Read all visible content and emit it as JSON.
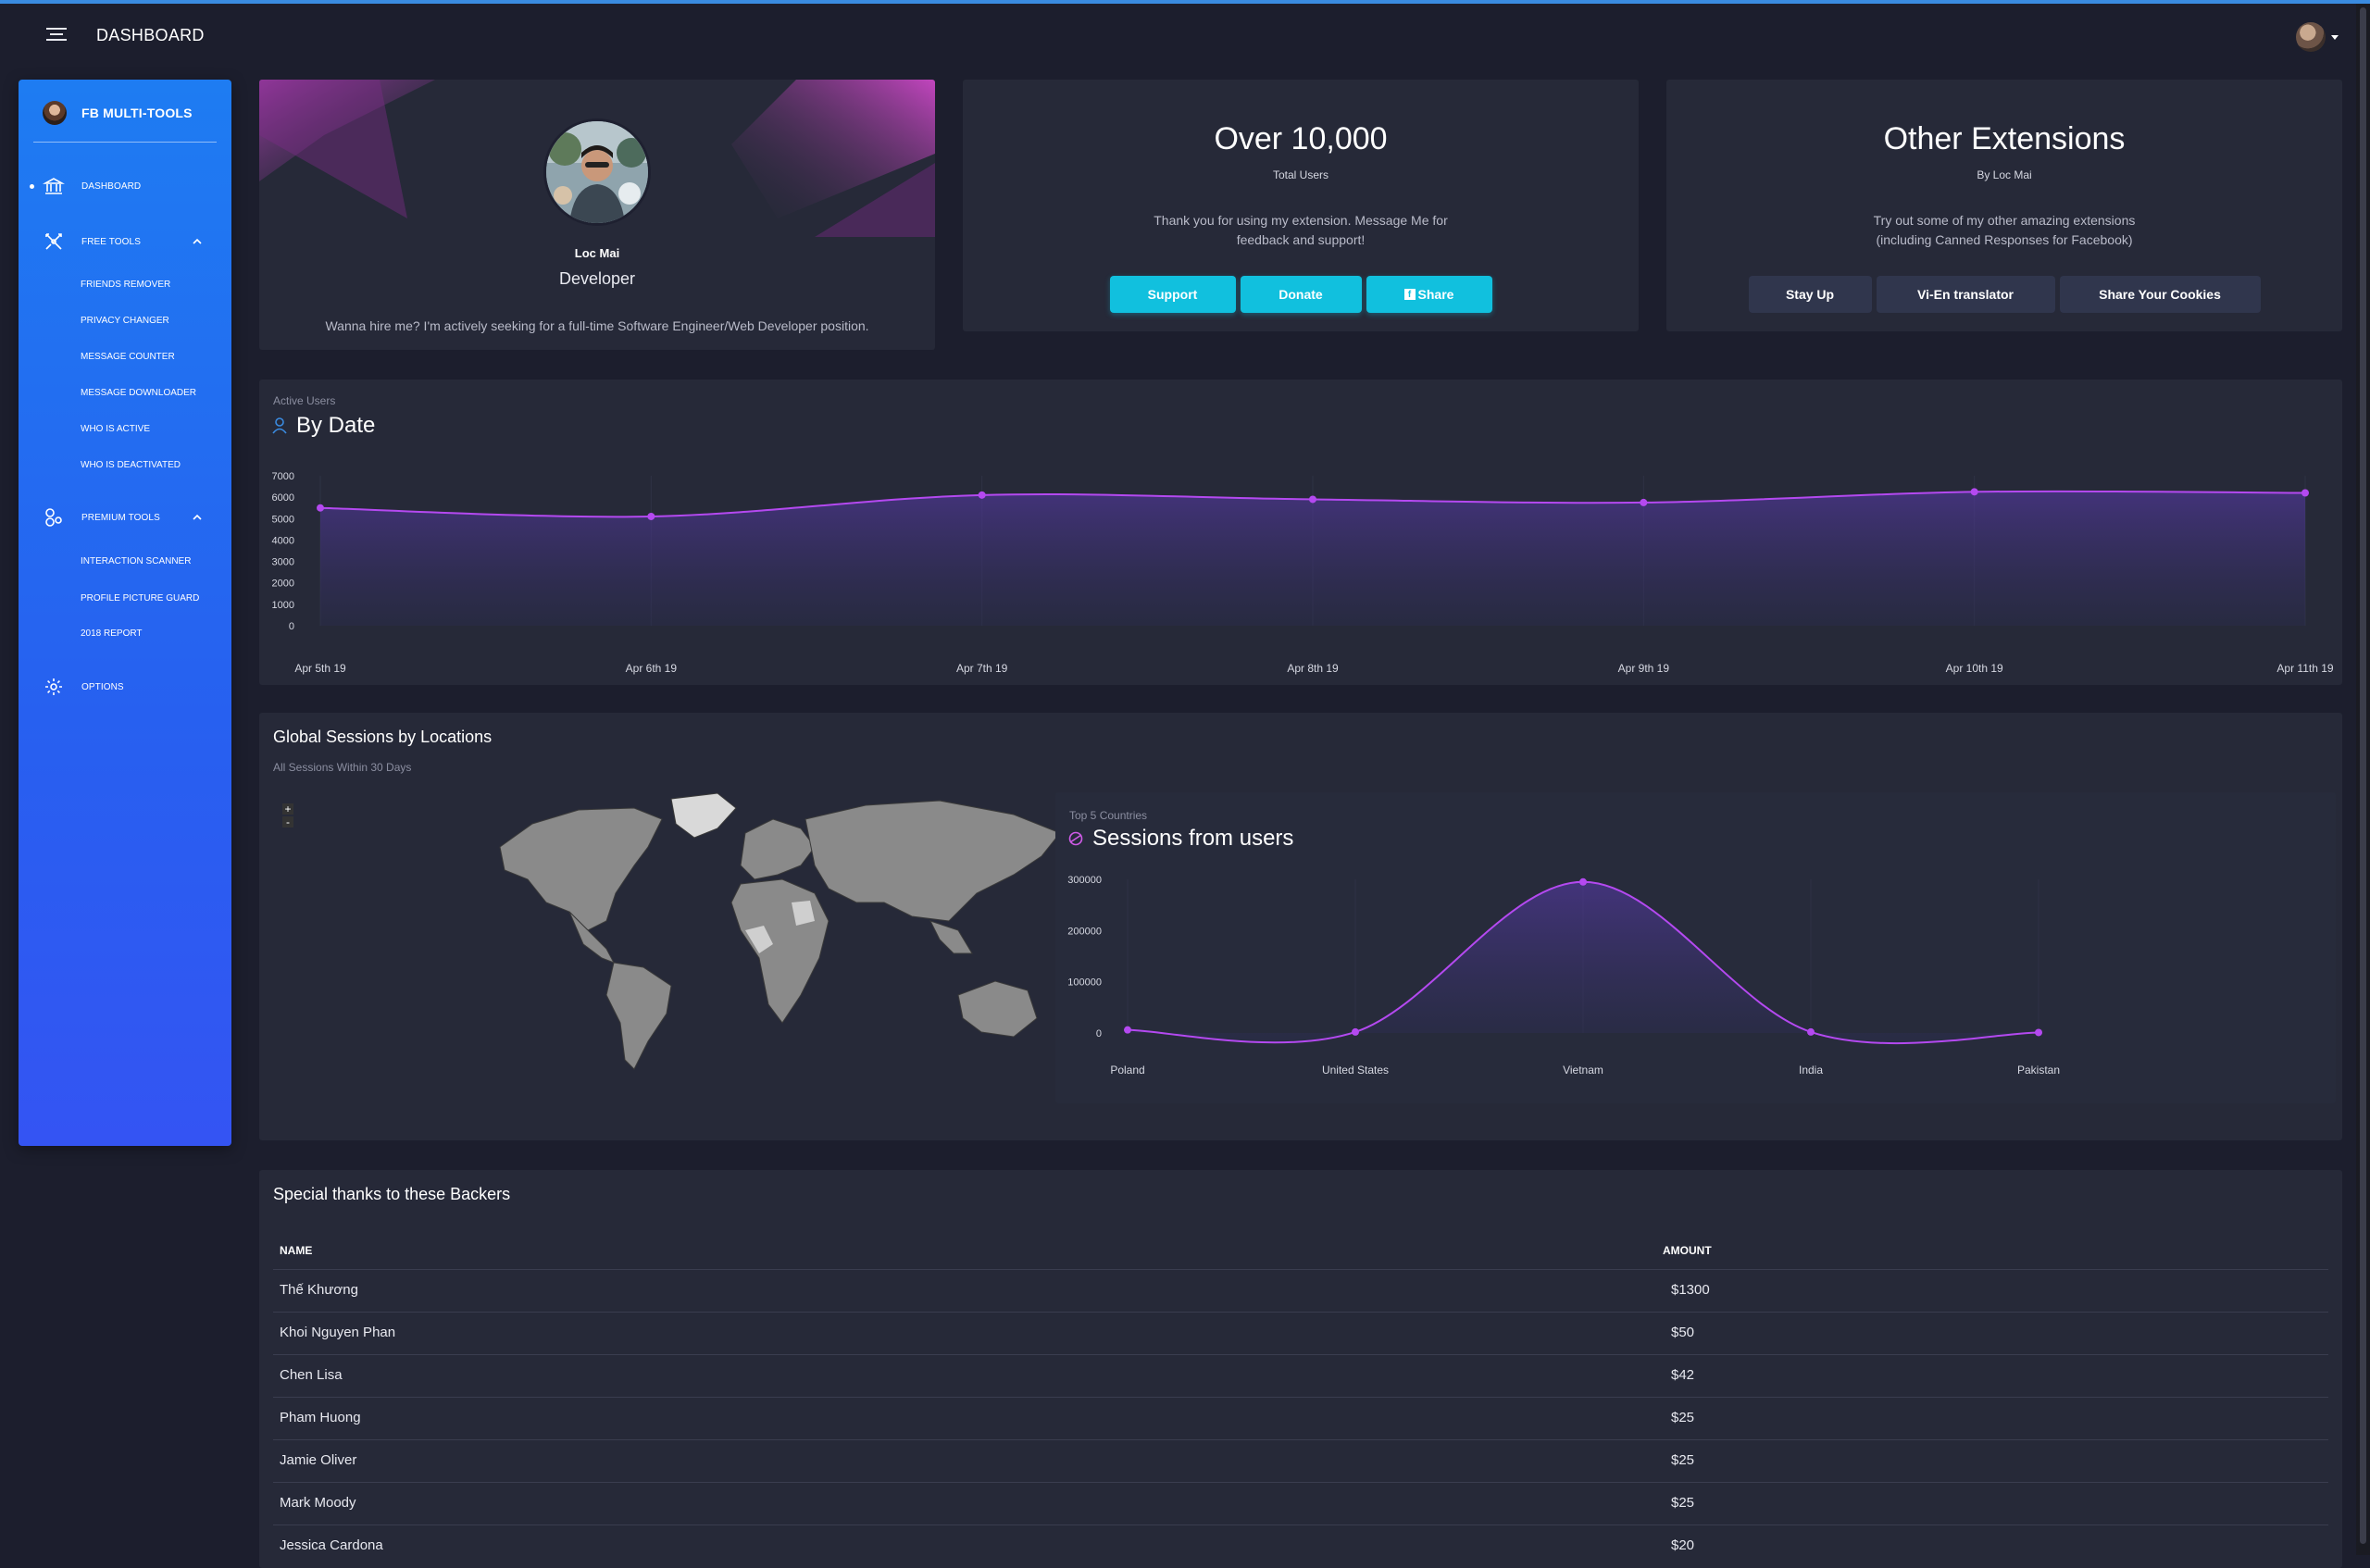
{
  "topbar": {
    "title": "DASHBOARD"
  },
  "sidebar": {
    "brand": "FB MULTI-TOOLS",
    "dashboard": "DASHBOARD",
    "free_tools": "FREE TOOLS",
    "free_items": [
      "FRIENDS REMOVER",
      "PRIVACY CHANGER",
      "MESSAGE COUNTER",
      "MESSAGE DOWNLOADER",
      "WHO IS ACTIVE",
      "WHO IS DEACTIVATED"
    ],
    "premium_tools": "PREMIUM TOOLS",
    "premium_items": [
      "INTERACTION SCANNER",
      "PROFILE PICTURE GUARD",
      "2018 REPORT"
    ],
    "options": "OPTIONS"
  },
  "profile": {
    "name": "Loc Mai",
    "role": "Developer",
    "pitch": "Wanna hire me? I'm actively seeking for a full-time Software Engineer/Web Developer position."
  },
  "users_card": {
    "title": "Over 10,000",
    "subtitle": "Total Users",
    "desc_line1": "Thank you for using my extension. Message Me for",
    "desc_line2": "feedback and support!",
    "buttons": [
      "Support",
      "Donate",
      "Share"
    ]
  },
  "ext_card": {
    "title": "Other Extensions",
    "subtitle": "By Loc Mai",
    "desc_line1": "Try out some of my other amazing extensions",
    "desc_line2": "(including Canned Responses for Facebook)",
    "buttons": [
      "Stay Up",
      "Vi-En translator",
      "Share Your Cookies"
    ]
  },
  "active_users": {
    "pre": "Active Users",
    "title": "By Date"
  },
  "geo": {
    "title": "Global Sessions by Locations",
    "subtitle": "All Sessions Within 30 Days",
    "zoom_in": "+",
    "zoom_out": "-",
    "inner_pre": "Top 5 Countries",
    "inner_title": "Sessions from users"
  },
  "backers": {
    "title": "Special thanks to these Backers",
    "col_name": "NAME",
    "col_amount": "AMOUNT",
    "rows": [
      {
        "name": "Thế Khương",
        "amount": "$1300"
      },
      {
        "name": "Khoi Nguyen Phan",
        "amount": "$50"
      },
      {
        "name": "Chen Lisa",
        "amount": "$42"
      },
      {
        "name": "Pham Huong",
        "amount": "$25"
      },
      {
        "name": "Jamie Oliver",
        "amount": "$25"
      },
      {
        "name": "Mark Moody",
        "amount": "$25"
      },
      {
        "name": "Jessica Cardona",
        "amount": "$20"
      }
    ]
  },
  "colors": {
    "accent_blue": "#1e7cf2",
    "cyan": "#11c0de",
    "purple": "#b449f0",
    "card_bg": "#262938",
    "page_bg": "#1c1e2d"
  },
  "chart_data": [
    {
      "type": "area",
      "title": "By Date",
      "categories": [
        "Apr 5th 19",
        "Apr 6th 19",
        "Apr 7th 19",
        "Apr 8th 19",
        "Apr 9th 19",
        "Apr 10th 19",
        "Apr 11th 19"
      ],
      "values": [
        5500,
        5100,
        6100,
        5900,
        5750,
        6250,
        6200
      ],
      "yticks": [
        0,
        1000,
        2000,
        3000,
        4000,
        5000,
        6000,
        7000
      ],
      "ylim": [
        0,
        7000
      ],
      "color": "#b449f0"
    },
    {
      "type": "area",
      "title": "Sessions from users",
      "categories": [
        "Poland",
        "United States",
        "Vietnam",
        "India",
        "Pakistan"
      ],
      "values": [
        6000,
        2000,
        295000,
        2000,
        1000
      ],
      "yticks": [
        0,
        100000,
        200000,
        300000
      ],
      "ylim": [
        0,
        300000
      ],
      "color": "#b449f0"
    }
  ]
}
